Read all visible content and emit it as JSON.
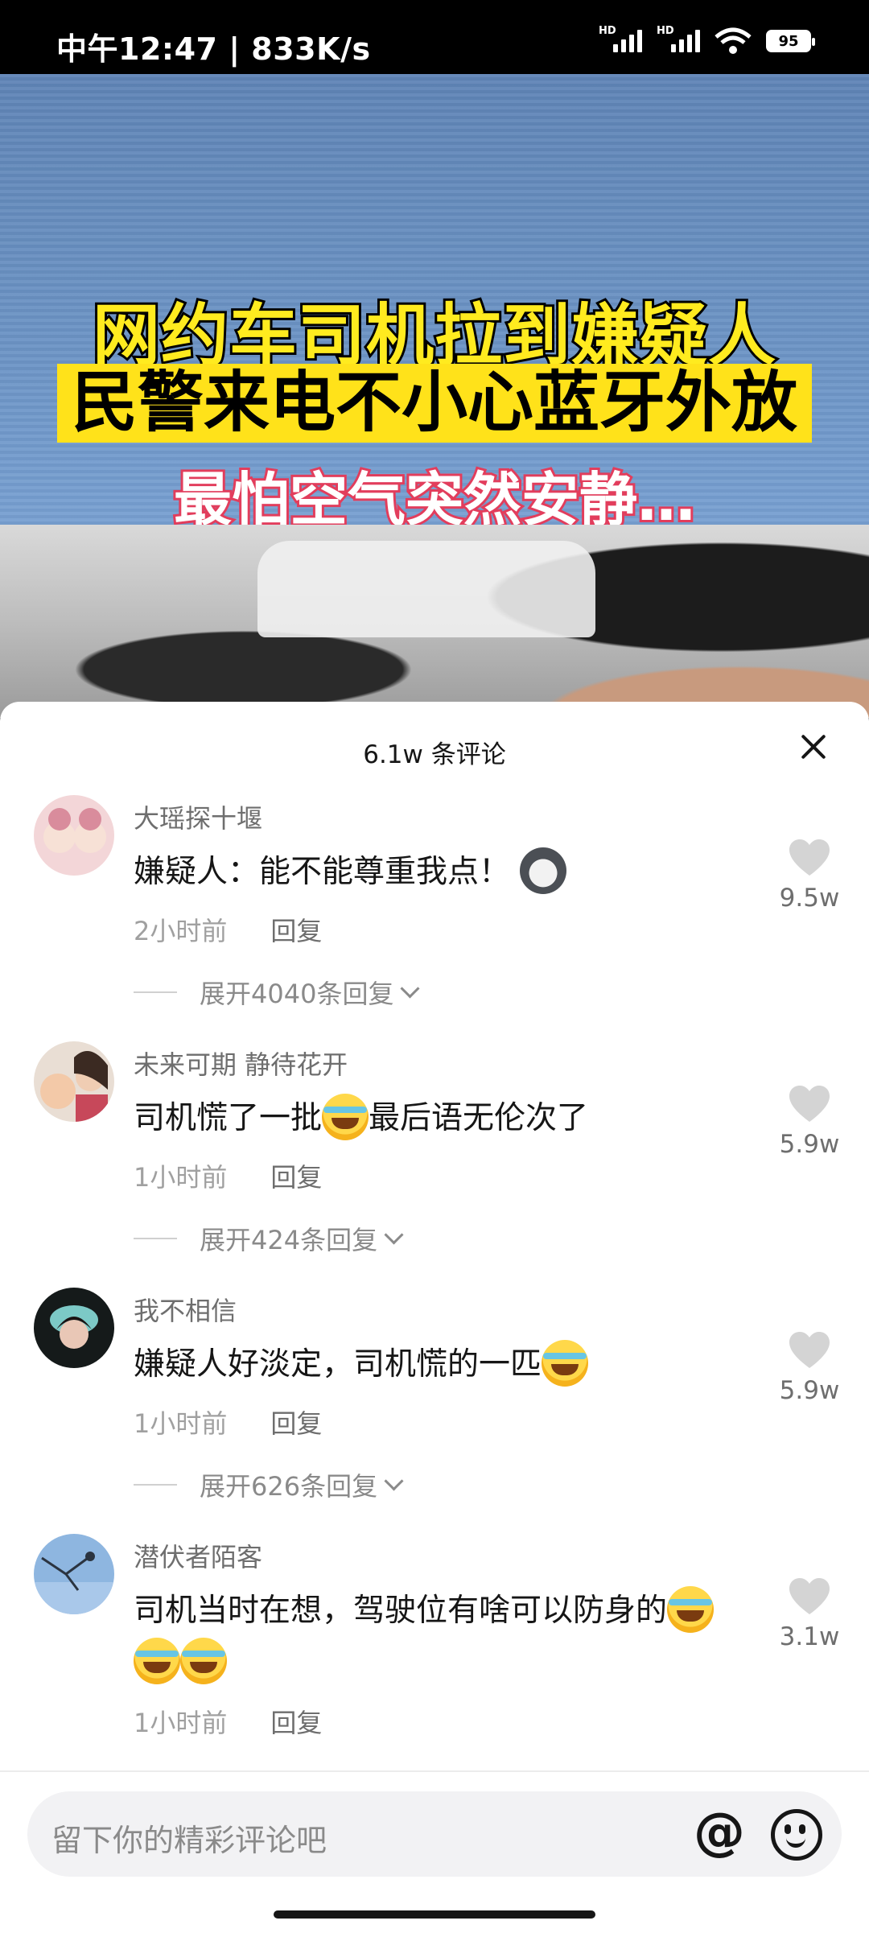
{
  "status_bar": {
    "time_speed": "中午12:47 | 833K/s",
    "battery": "95"
  },
  "video": {
    "caption_line1": "网约车司机拉到嫌疑人",
    "caption_line2": "民警来电不小心蓝牙外放",
    "caption_line3": "最怕空气突然安静…"
  },
  "sheet": {
    "title": "6.1w 条评论"
  },
  "comments": [
    {
      "username": "大瑶探十堰",
      "text": "嫌疑人：能不能尊重我点！",
      "emoji": "husky-dog-emoji",
      "time": "2小时前",
      "reply": "回复",
      "expand": "展开4040条回复",
      "likes": "9.5w"
    },
    {
      "username": "未来可期 静待花开",
      "text_a": "司机慌了一批",
      "text_b": "最后语无伦次了",
      "time": "1小时前",
      "reply": "回复",
      "expand": "展开424条回复",
      "likes": "5.9w"
    },
    {
      "username": "我不相信",
      "text": "嫌疑人好淡定，司机慌的一匹",
      "time": "1小时前",
      "reply": "回复",
      "expand": "展开626条回复",
      "likes": "5.9w"
    },
    {
      "username": "潜伏者陌客",
      "text": "司机当时在想，驾驶位有啥可以防身的",
      "time": "1小时前",
      "reply": "回复",
      "likes": "3.1w"
    }
  ],
  "input": {
    "placeholder": "留下你的精彩评论吧"
  },
  "colors": {
    "accent_text": "#161616",
    "secondary_text": "#6e6e6e",
    "caption_yellow": "#ffe21a"
  }
}
